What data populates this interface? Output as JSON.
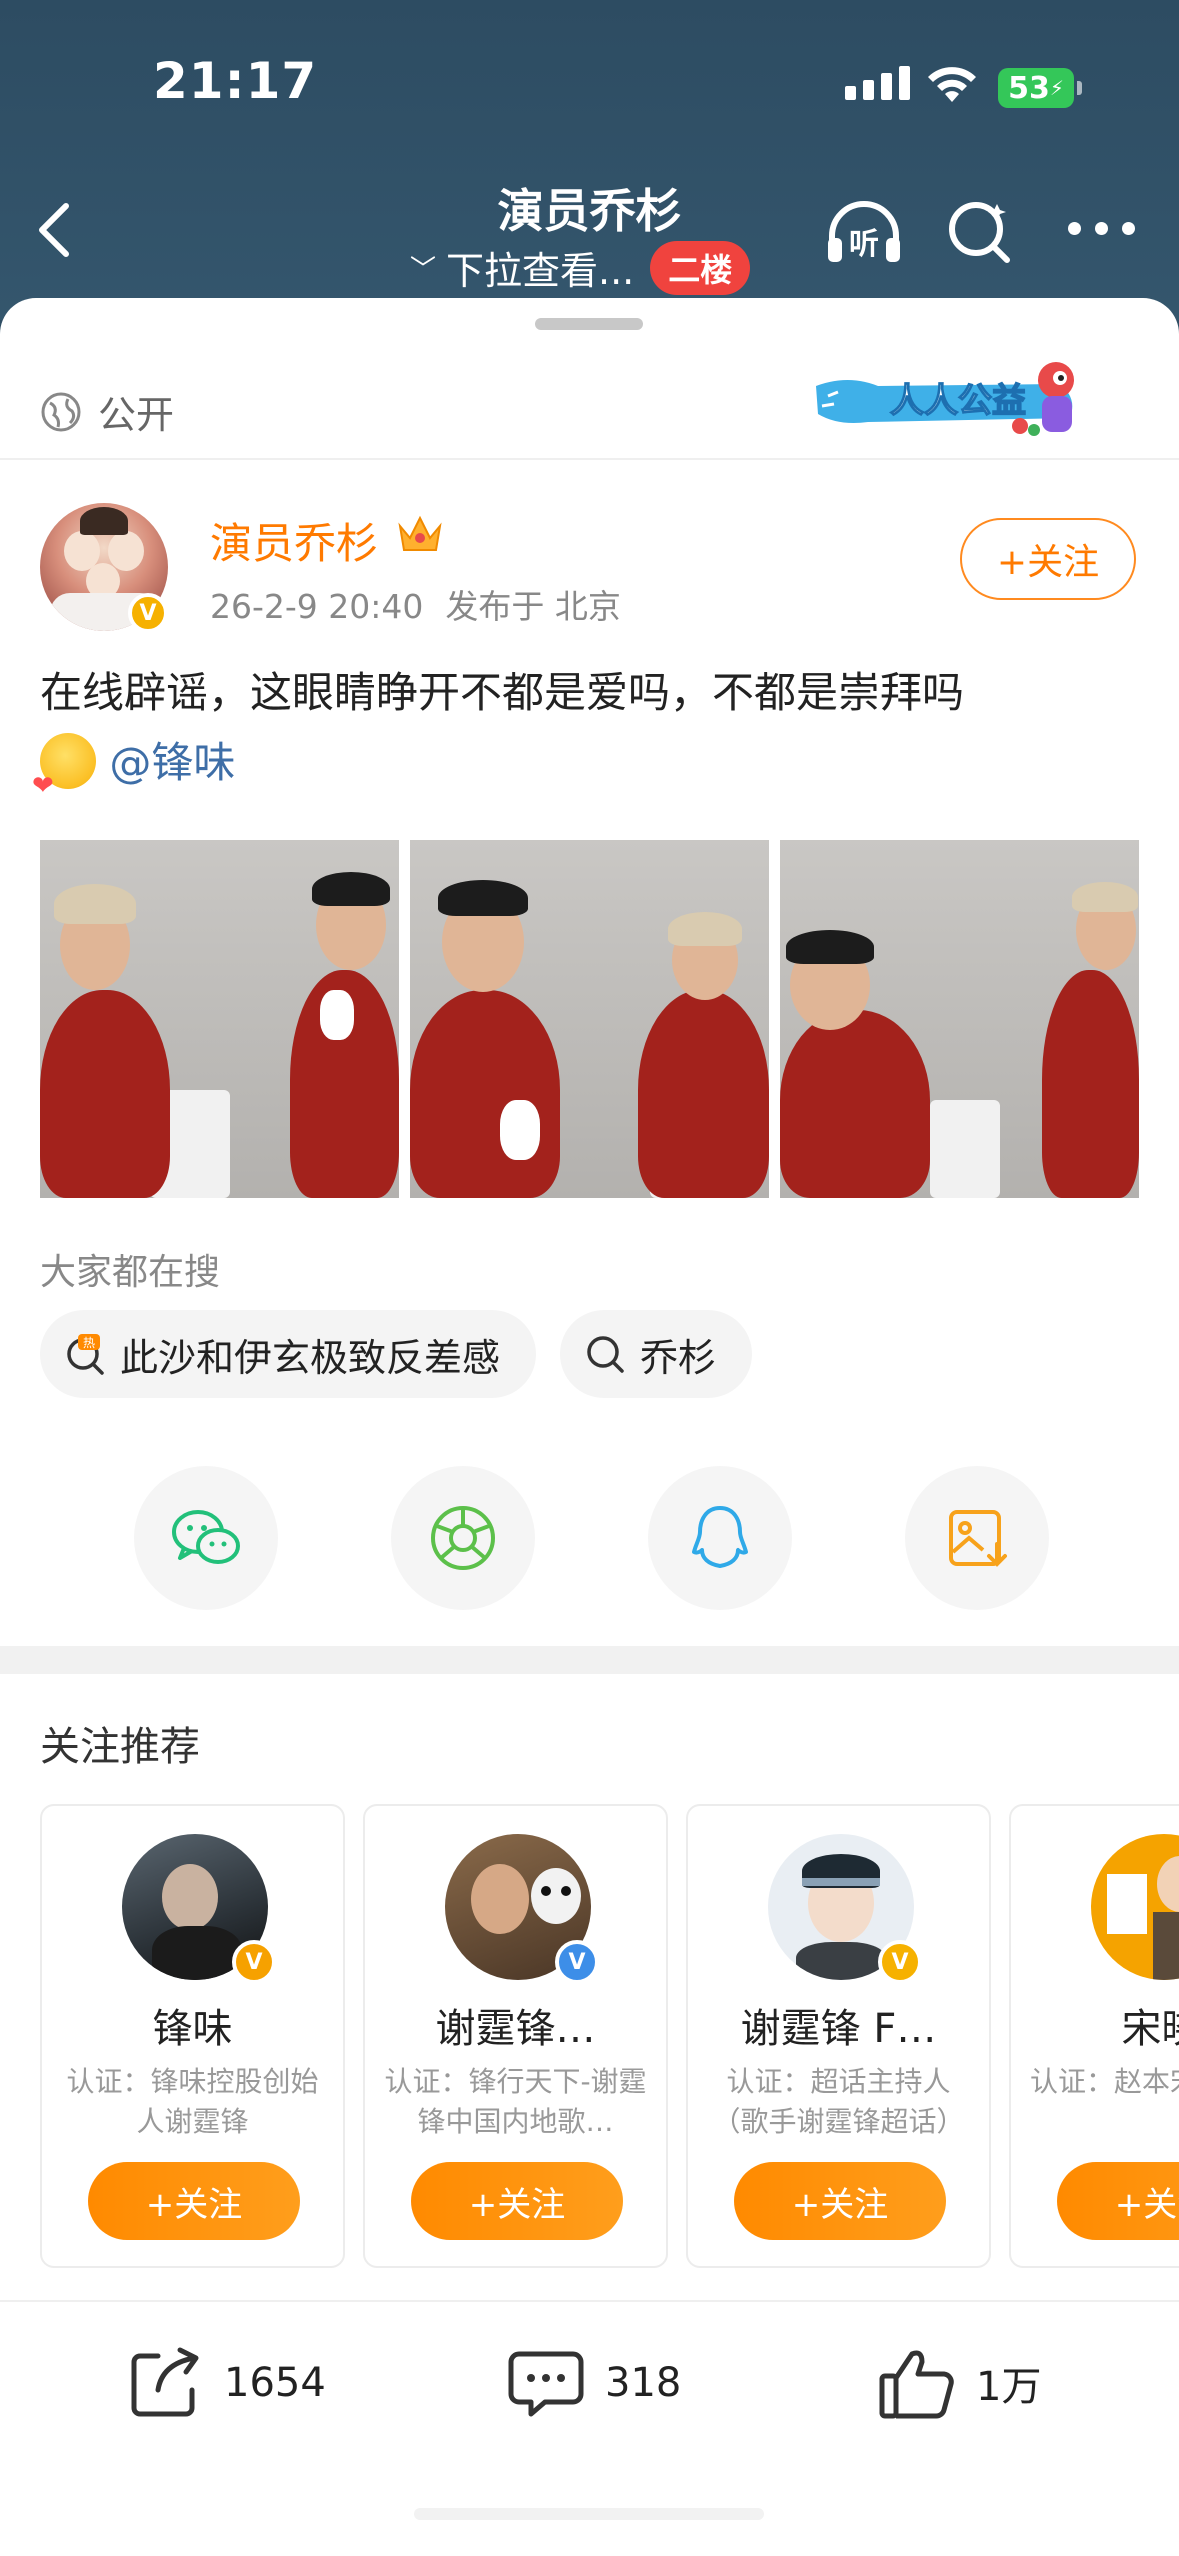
{
  "status": {
    "time": "21:17",
    "battery": "53"
  },
  "nav": {
    "title": "演员乔杉",
    "subtitle": "下拉查看...",
    "floor_badge": "二楼"
  },
  "visibility": {
    "label": "公开"
  },
  "banner": {
    "text": "人人公益"
  },
  "post": {
    "author": "演员乔杉",
    "date": "26-2-9 20:40",
    "location": "发布于 北京",
    "follow_label": "+关注",
    "text": "在线辟谣，这眼睛睁开不都是爱吗，不都是崇拜吗",
    "mention": "@锋味"
  },
  "hot_search": {
    "title": "大家都在搜",
    "chips": [
      {
        "label": "此沙和伊玄极致反差感",
        "icon": "hot-search-icon"
      },
      {
        "label": "乔杉",
        "icon": "search-icon"
      }
    ]
  },
  "share": {
    "items": [
      "wechat-icon",
      "moments-icon",
      "qq-icon",
      "save-image-icon"
    ]
  },
  "recommend": {
    "title": "关注推荐",
    "follow_label": "+关注",
    "cards": [
      {
        "name": "锋味",
        "desc": "认证：锋味控股创始人谢霆锋",
        "badge_color": "#f6a100"
      },
      {
        "name": "谢霆锋…",
        "desc": "认证：锋行天下-谢霆锋中国内地歌…",
        "badge_color": "#3d8ee8"
      },
      {
        "name": "谢霆锋 F…",
        "desc": "认证：超话主持人（歌手谢霆锋超话）",
        "badge_color": "#f6b100"
      },
      {
        "name": "宋晓",
        "desc": "认证：赵本宋晓峰，(",
        "badge_color": "#f6a100"
      }
    ]
  },
  "actions": {
    "repost": "1654",
    "comment": "318",
    "like": "1万"
  },
  "colors": {
    "accent": "#ff7a00",
    "header_bg": "#2f4e64",
    "link": "#3e6ea7"
  }
}
